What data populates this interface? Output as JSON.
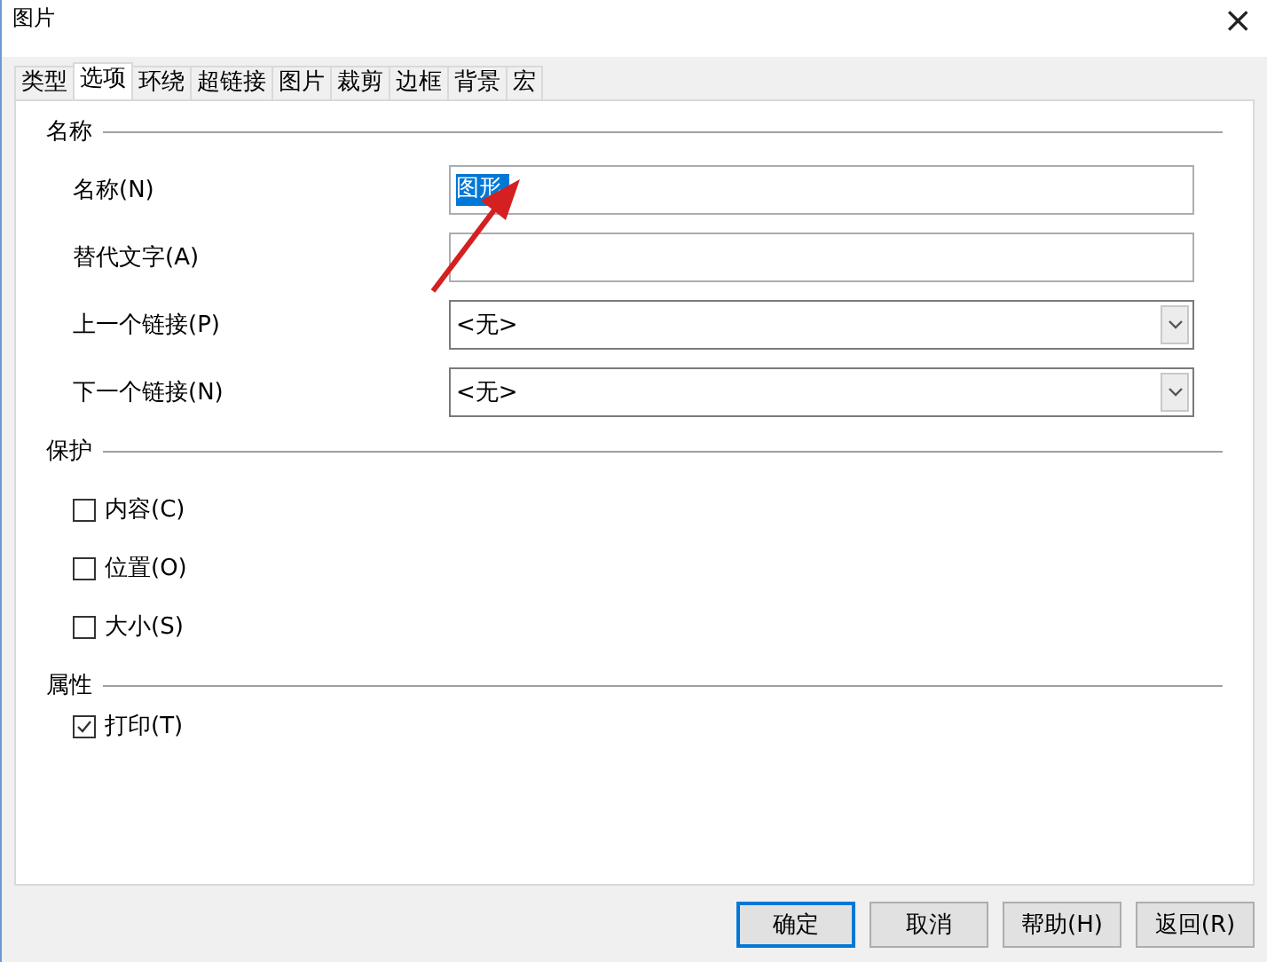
{
  "window": {
    "title": "图片",
    "close": "×"
  },
  "tabs": [
    {
      "label": "类型",
      "selected": false
    },
    {
      "label": "选项",
      "selected": true
    },
    {
      "label": "环绕",
      "selected": false
    },
    {
      "label": "超链接",
      "selected": false
    },
    {
      "label": "图片",
      "selected": false
    },
    {
      "label": "裁剪",
      "selected": false
    },
    {
      "label": "边框",
      "selected": false
    },
    {
      "label": "背景",
      "selected": false
    },
    {
      "label": "宏",
      "selected": false
    }
  ],
  "sections": [
    {
      "title": "名称",
      "rows": [
        {
          "kind": "text",
          "label": "名称(N)",
          "value": "图形",
          "selected": true
        },
        {
          "kind": "text",
          "label": "替代文字(A)"
        },
        {
          "kind": "dropdown",
          "label": "上一个链接(P)",
          "value": "<无>"
        },
        {
          "kind": "dropdown",
          "label": "下一个链接(N)",
          "value": "<无>"
        }
      ]
    },
    {
      "title": "保护",
      "rows": [
        {
          "kind": "checkbox",
          "label": "内容(C)",
          "checked": false
        },
        {
          "kind": "checkbox",
          "label": "位置(O)",
          "checked": false
        },
        {
          "kind": "checkbox",
          "label": "大小(S)",
          "checked": false
        }
      ]
    },
    {
      "title": "属性",
      "rows": [
        {
          "kind": "checkbox",
          "label": "打印(T)",
          "checked": true
        }
      ]
    }
  ],
  "buttons": [
    {
      "label": "确定",
      "default": true
    },
    {
      "label": "取消",
      "default": false
    },
    {
      "label": "帮助(H)",
      "default": false
    },
    {
      "label": "返回(R)",
      "default": false
    }
  ]
}
